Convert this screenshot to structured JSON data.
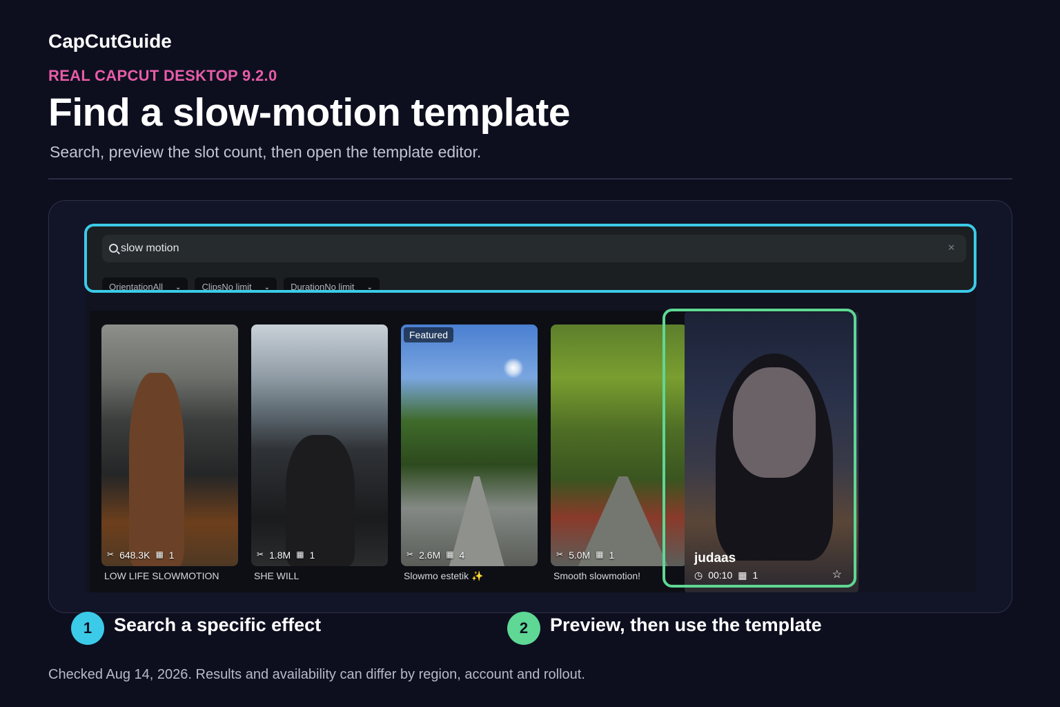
{
  "header": {
    "brand": "CapCutGuide",
    "eyebrow": "REAL CAPCUT DESKTOP 9.2.0",
    "title": "Find a slow-motion template",
    "subtitle": "Search, preview the slot count, then open the template editor."
  },
  "screenshot": {
    "search": {
      "value": "slow motion",
      "clear_icon": "close-icon"
    },
    "filters": [
      {
        "label": "OrientationAll"
      },
      {
        "label": "ClipsNo limit"
      },
      {
        "label": "DurationNo limit"
      }
    ],
    "templates": [
      {
        "uses": "648.3K",
        "clips": "1",
        "label": "LOW LIFE SLOWMOTION",
        "badge": ""
      },
      {
        "uses": "1.8M",
        "clips": "1",
        "label": "SHE WILL",
        "badge": ""
      },
      {
        "uses": "2.6M",
        "clips": "4",
        "label": "Slowmo estetik ✨",
        "badge": "Featured"
      },
      {
        "uses": "5.0M",
        "clips": "1",
        "label": "Smooth slowmotion!",
        "badge": ""
      }
    ],
    "preview": {
      "name": "judaas",
      "duration": "00:10",
      "clips": "1"
    }
  },
  "steps": [
    {
      "number": "1",
      "label": "Search a specific effect",
      "color": "#3bcbe8"
    },
    {
      "number": "2",
      "label": "Preview, then use the template",
      "color": "#5fd795"
    }
  ],
  "footnote": "Checked Aug 14, 2026. Results and availability can differ by region, account and rollout.",
  "colors": {
    "background": "#0d0f1f",
    "accent_pink": "#e85ca8",
    "highlight_search": "#3bcbe8",
    "highlight_preview": "#5fd795"
  }
}
